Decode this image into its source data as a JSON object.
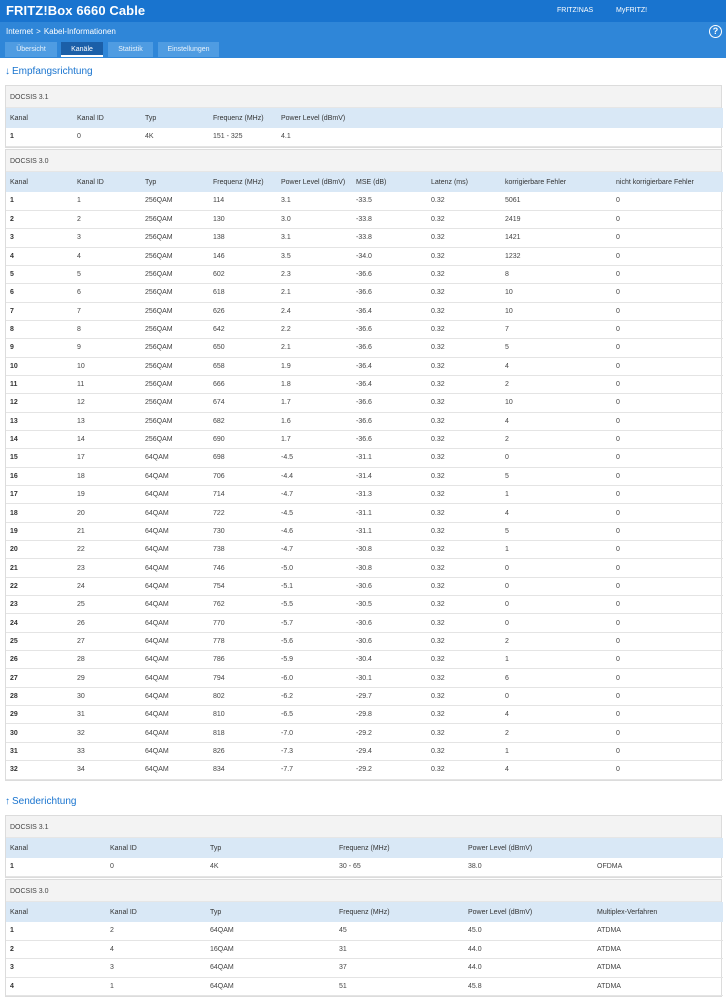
{
  "header": {
    "title": "FRITZ!Box 6660 Cable",
    "links": [
      "FRITZ!NAS",
      "MyFRITZ!"
    ]
  },
  "breadcrumb": {
    "parent": "Internet",
    "separator": ">",
    "current": "Kabel-Informationen",
    "help": "?"
  },
  "tabs": [
    "Übersicht",
    "Kanäle",
    "Statistik",
    "Einstellungen"
  ],
  "active_tab": "Kanäle",
  "downstream": {
    "title": "Empfangsrichtung",
    "docsis31": {
      "label": "DOCSIS 3.1",
      "columns": [
        "Kanal",
        "Kanal ID",
        "Typ",
        "Frequenz (MHz)",
        "Power Level (dBmV)"
      ],
      "rows": [
        [
          "1",
          "0",
          "4K",
          "151 - 325",
          "4.1"
        ]
      ]
    },
    "docsis30": {
      "label": "DOCSIS 3.0",
      "columns": [
        "Kanal",
        "Kanal ID",
        "Typ",
        "Frequenz (MHz)",
        "Power Level (dBmV)",
        "MSE (dB)",
        "Latenz (ms)",
        "korrigierbare Fehler",
        "nicht korrigierbare Fehler"
      ],
      "rows": [
        [
          "1",
          "1",
          "256QAM",
          "114",
          "3.1",
          "-33.5",
          "0.32",
          "5061",
          "0"
        ],
        [
          "2",
          "2",
          "256QAM",
          "130",
          "3.0",
          "-33.8",
          "0.32",
          "2419",
          "0"
        ],
        [
          "3",
          "3",
          "256QAM",
          "138",
          "3.1",
          "-33.8",
          "0.32",
          "1421",
          "0"
        ],
        [
          "4",
          "4",
          "256QAM",
          "146",
          "3.5",
          "-34.0",
          "0.32",
          "1232",
          "0"
        ],
        [
          "5",
          "5",
          "256QAM",
          "602",
          "2.3",
          "-36.6",
          "0.32",
          "8",
          "0"
        ],
        [
          "6",
          "6",
          "256QAM",
          "618",
          "2.1",
          "-36.6",
          "0.32",
          "10",
          "0"
        ],
        [
          "7",
          "7",
          "256QAM",
          "626",
          "2.4",
          "-36.4",
          "0.32",
          "10",
          "0"
        ],
        [
          "8",
          "8",
          "256QAM",
          "642",
          "2.2",
          "-36.6",
          "0.32",
          "7",
          "0"
        ],
        [
          "9",
          "9",
          "256QAM",
          "650",
          "2.1",
          "-36.6",
          "0.32",
          "5",
          "0"
        ],
        [
          "10",
          "10",
          "256QAM",
          "658",
          "1.9",
          "-36.4",
          "0.32",
          "4",
          "0"
        ],
        [
          "11",
          "11",
          "256QAM",
          "666",
          "1.8",
          "-36.4",
          "0.32",
          "2",
          "0"
        ],
        [
          "12",
          "12",
          "256QAM",
          "674",
          "1.7",
          "-36.6",
          "0.32",
          "10",
          "0"
        ],
        [
          "13",
          "13",
          "256QAM",
          "682",
          "1.6",
          "-36.6",
          "0.32",
          "4",
          "0"
        ],
        [
          "14",
          "14",
          "256QAM",
          "690",
          "1.7",
          "-36.6",
          "0.32",
          "2",
          "0"
        ],
        [
          "15",
          "17",
          "64QAM",
          "698",
          "-4.5",
          "-31.1",
          "0.32",
          "0",
          "0"
        ],
        [
          "16",
          "18",
          "64QAM",
          "706",
          "-4.4",
          "-31.4",
          "0.32",
          "5",
          "0"
        ],
        [
          "17",
          "19",
          "64QAM",
          "714",
          "-4.7",
          "-31.3",
          "0.32",
          "1",
          "0"
        ],
        [
          "18",
          "20",
          "64QAM",
          "722",
          "-4.5",
          "-31.1",
          "0.32",
          "4",
          "0"
        ],
        [
          "19",
          "21",
          "64QAM",
          "730",
          "-4.6",
          "-31.1",
          "0.32",
          "5",
          "0"
        ],
        [
          "20",
          "22",
          "64QAM",
          "738",
          "-4.7",
          "-30.8",
          "0.32",
          "1",
          "0"
        ],
        [
          "21",
          "23",
          "64QAM",
          "746",
          "-5.0",
          "-30.8",
          "0.32",
          "0",
          "0"
        ],
        [
          "22",
          "24",
          "64QAM",
          "754",
          "-5.1",
          "-30.6",
          "0.32",
          "0",
          "0"
        ],
        [
          "23",
          "25",
          "64QAM",
          "762",
          "-5.5",
          "-30.5",
          "0.32",
          "0",
          "0"
        ],
        [
          "24",
          "26",
          "64QAM",
          "770",
          "-5.7",
          "-30.6",
          "0.32",
          "0",
          "0"
        ],
        [
          "25",
          "27",
          "64QAM",
          "778",
          "-5.6",
          "-30.6",
          "0.32",
          "2",
          "0"
        ],
        [
          "26",
          "28",
          "64QAM",
          "786",
          "-5.9",
          "-30.4",
          "0.32",
          "1",
          "0"
        ],
        [
          "27",
          "29",
          "64QAM",
          "794",
          "-6.0",
          "-30.1",
          "0.32",
          "6",
          "0"
        ],
        [
          "28",
          "30",
          "64QAM",
          "802",
          "-6.2",
          "-29.7",
          "0.32",
          "0",
          "0"
        ],
        [
          "29",
          "31",
          "64QAM",
          "810",
          "-6.5",
          "-29.8",
          "0.32",
          "4",
          "0"
        ],
        [
          "30",
          "32",
          "64QAM",
          "818",
          "-7.0",
          "-29.2",
          "0.32",
          "2",
          "0"
        ],
        [
          "31",
          "33",
          "64QAM",
          "826",
          "-7.3",
          "-29.4",
          "0.32",
          "1",
          "0"
        ],
        [
          "32",
          "34",
          "64QAM",
          "834",
          "-7.7",
          "-29.2",
          "0.32",
          "4",
          "0"
        ]
      ]
    }
  },
  "upstream": {
    "title": "Senderichtung",
    "docsis31": {
      "label": "DOCSIS 3.1",
      "columns": [
        "Kanal",
        "Kanal ID",
        "Typ",
        "Frequenz (MHz)",
        "Power Level (dBmV)",
        ""
      ],
      "rows": [
        [
          "1",
          "0",
          "4K",
          "30 - 65",
          "38.0",
          "OFDMA"
        ]
      ]
    },
    "docsis30": {
      "label": "DOCSIS 3.0",
      "columns": [
        "Kanal",
        "Kanal ID",
        "Typ",
        "Frequenz (MHz)",
        "Power Level (dBmV)",
        "Multiplex-Verfahren"
      ],
      "rows": [
        [
          "1",
          "2",
          "64QAM",
          "45",
          "45.0",
          "ATDMA"
        ],
        [
          "2",
          "4",
          "16QAM",
          "31",
          "44.0",
          "ATDMA"
        ],
        [
          "3",
          "3",
          "64QAM",
          "37",
          "44.0",
          "ATDMA"
        ],
        [
          "4",
          "1",
          "64QAM",
          "51",
          "45.8",
          "ATDMA"
        ]
      ]
    }
  }
}
